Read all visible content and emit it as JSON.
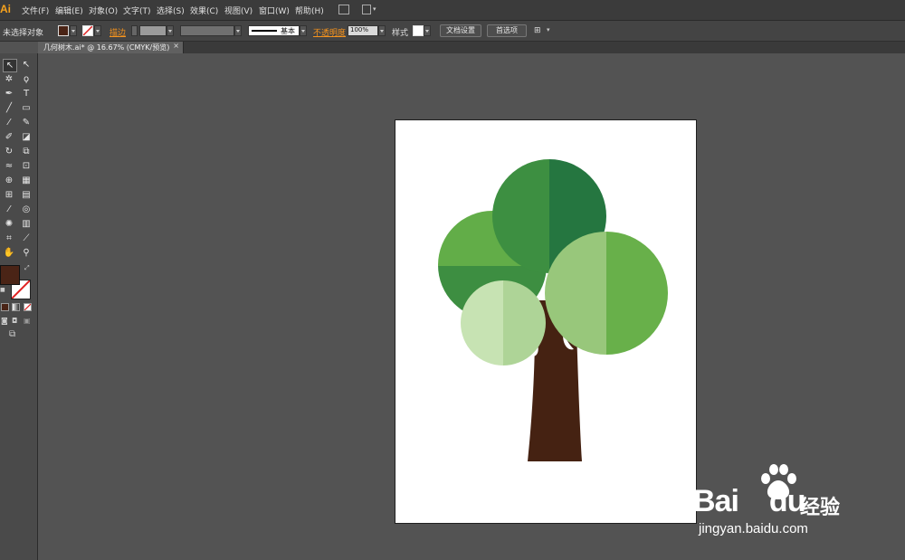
{
  "app": {
    "logo": "Ai"
  },
  "menu": [
    "文件(F)",
    "编辑(E)",
    "对象(O)",
    "文字(T)",
    "选择(S)",
    "效果(C)",
    "视图(V)",
    "窗口(W)",
    "帮助(H)"
  ],
  "control_bar": {
    "selection_status": "未选择对象",
    "stroke_label": "描边",
    "stroke_style": "基本",
    "opacity_label": "不透明度",
    "opacity_value": "100%",
    "style_label": "样式",
    "document_setup": "文档设置",
    "preferences": "首选项",
    "fill_color": "#4a2416",
    "none_color": "#ffffff"
  },
  "document_tab": {
    "label": "几何树木.ai* @ 16.67% (CMYK/预览)",
    "close": "×"
  },
  "tools": {
    "fill_color": "#4a2416",
    "stroke_color": "#ffffff"
  },
  "artwork": {
    "trunk_color": "#452212",
    "colors": {
      "dark_green_a": "#3d8f41",
      "dark_green_b": "#257640",
      "mid_green_a": "#62ad48",
      "mid_green_b": "#3d8e41",
      "light_green_a": "#98c77b",
      "light_green_b": "#68b04a",
      "pale_green_a": "#c7e3b3",
      "pale_green_b": "#aed497"
    }
  },
  "watermark": {
    "brand": "Bai",
    "brand2": "du",
    "jingyan": "经验",
    "url": "jingyan.baidu.com"
  }
}
